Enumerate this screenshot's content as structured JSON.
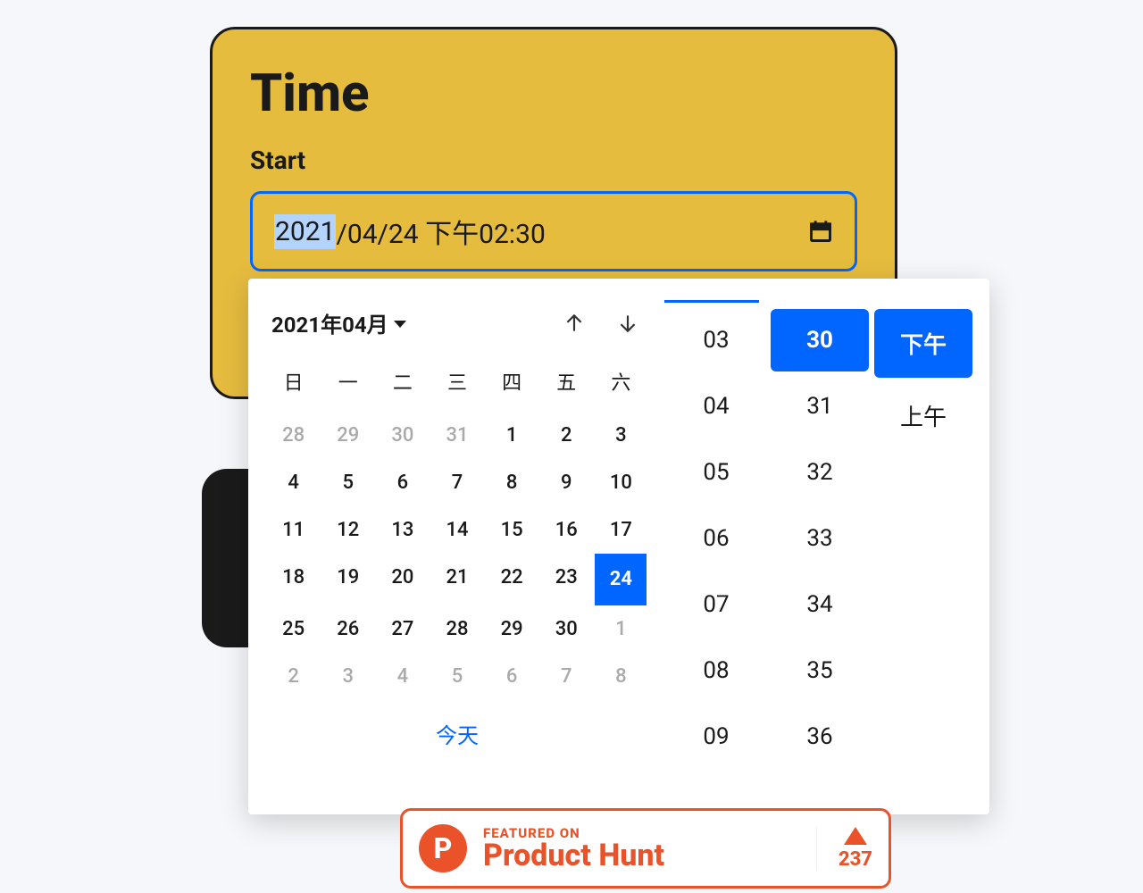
{
  "card": {
    "title": "Time",
    "start_label": "Start"
  },
  "datetime": {
    "year": "2021",
    "rest": "/04/24 下午02:30"
  },
  "calendar": {
    "month_label": "2021年04月",
    "weekdays": [
      "日",
      "一",
      "二",
      "三",
      "四",
      "五",
      "六"
    ],
    "days": [
      {
        "d": "28",
        "muted": true
      },
      {
        "d": "29",
        "muted": true
      },
      {
        "d": "30",
        "muted": true
      },
      {
        "d": "31",
        "muted": true
      },
      {
        "d": "1"
      },
      {
        "d": "2"
      },
      {
        "d": "3"
      },
      {
        "d": "4"
      },
      {
        "d": "5"
      },
      {
        "d": "6"
      },
      {
        "d": "7"
      },
      {
        "d": "8"
      },
      {
        "d": "9"
      },
      {
        "d": "10"
      },
      {
        "d": "11"
      },
      {
        "d": "12"
      },
      {
        "d": "13"
      },
      {
        "d": "14"
      },
      {
        "d": "15"
      },
      {
        "d": "16"
      },
      {
        "d": "17"
      },
      {
        "d": "18"
      },
      {
        "d": "19"
      },
      {
        "d": "20"
      },
      {
        "d": "21"
      },
      {
        "d": "22"
      },
      {
        "d": "23"
      },
      {
        "d": "24",
        "selected": true
      },
      {
        "d": "25"
      },
      {
        "d": "26"
      },
      {
        "d": "27"
      },
      {
        "d": "28"
      },
      {
        "d": "29"
      },
      {
        "d": "30"
      },
      {
        "d": "1",
        "muted": true
      },
      {
        "d": "2",
        "muted": true
      },
      {
        "d": "3",
        "muted": true
      },
      {
        "d": "4",
        "muted": true
      },
      {
        "d": "5",
        "muted": true
      },
      {
        "d": "6",
        "muted": true
      },
      {
        "d": "7",
        "muted": true
      },
      {
        "d": "8",
        "muted": true
      }
    ],
    "today_label": "今天"
  },
  "time_picker": {
    "hours": [
      "03",
      "04",
      "05",
      "06",
      "07",
      "08",
      "09"
    ],
    "minutes": [
      {
        "v": "30",
        "selected": true
      },
      {
        "v": "31"
      },
      {
        "v": "32"
      },
      {
        "v": "33"
      },
      {
        "v": "34"
      },
      {
        "v": "35"
      },
      {
        "v": "36"
      }
    ],
    "ampm": [
      {
        "v": "下午",
        "selected": true
      },
      {
        "v": "上午"
      }
    ]
  },
  "ph": {
    "logo_letter": "P",
    "featured": "FEATURED ON",
    "name": "Product Hunt",
    "count": "237"
  }
}
